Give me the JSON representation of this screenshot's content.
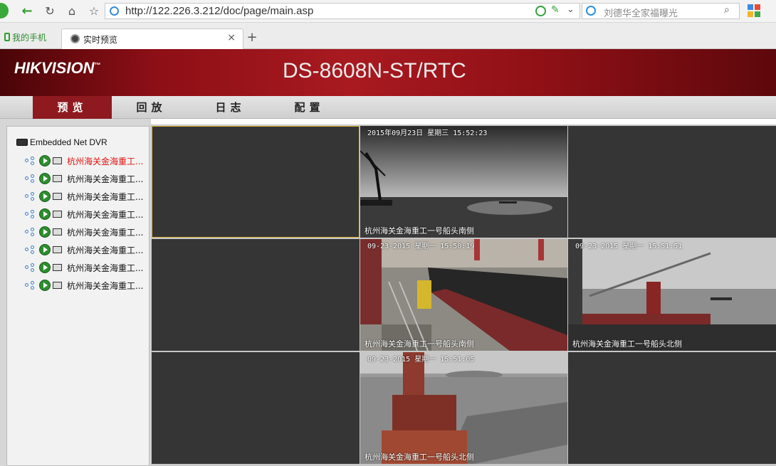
{
  "browser": {
    "url": "http://122.226.3.212/doc/page/main.asp",
    "search_placeholder": "刘德华全家福曝光",
    "bookmark_label": "我的手机",
    "tab_title": "实时预览",
    "tab_close": "×",
    "new_tab": "+"
  },
  "header": {
    "logo": "HIKVISION",
    "device_title": "DS-8608N-ST/RTC"
  },
  "menu": [
    {
      "label": "预览",
      "active": true
    },
    {
      "label": "回放",
      "active": false
    },
    {
      "label": "日志",
      "active": false
    },
    {
      "label": "配置",
      "active": false
    }
  ],
  "tree": {
    "root": "Embedded Net DVR",
    "channels": [
      {
        "label": "杭州海关金海重工...",
        "selected": true
      },
      {
        "label": "杭州海关金海重工...",
        "selected": false
      },
      {
        "label": "杭州海关金海重工...",
        "selected": false
      },
      {
        "label": "杭州海关金海重工...",
        "selected": false
      },
      {
        "label": "杭州海关金海重工...",
        "selected": false
      },
      {
        "label": "杭州海关金海重工...",
        "selected": false
      },
      {
        "label": "杭州海关金海重工...",
        "selected": false
      },
      {
        "label": "杭州海关金海重工...",
        "selected": false
      }
    ]
  },
  "feeds": {
    "cam1": {
      "time": "2015年09月23日 星期三 15:52:23",
      "name": "杭州海关金海重工一号船头南侧"
    },
    "cam2": {
      "time": "09-23-2015 星期一 15:50:19",
      "name": "杭州海关金海重工一号船头南侧"
    },
    "cam3": {
      "time": "09-23-2015 星期一 15:51:51",
      "name": "杭州海关金海重工一号船头北侧"
    },
    "cam4": {
      "time": "09-23-2015 星期一 15:51:05",
      "name": "杭州海关金海重工一号船头北侧"
    }
  },
  "colors": {
    "header_red": "#8d0f16",
    "menu_active": "#8e1a1f",
    "selected_channel": "#e01010",
    "cell_bg": "#353535",
    "cell_select_border": "#d8b23a"
  }
}
